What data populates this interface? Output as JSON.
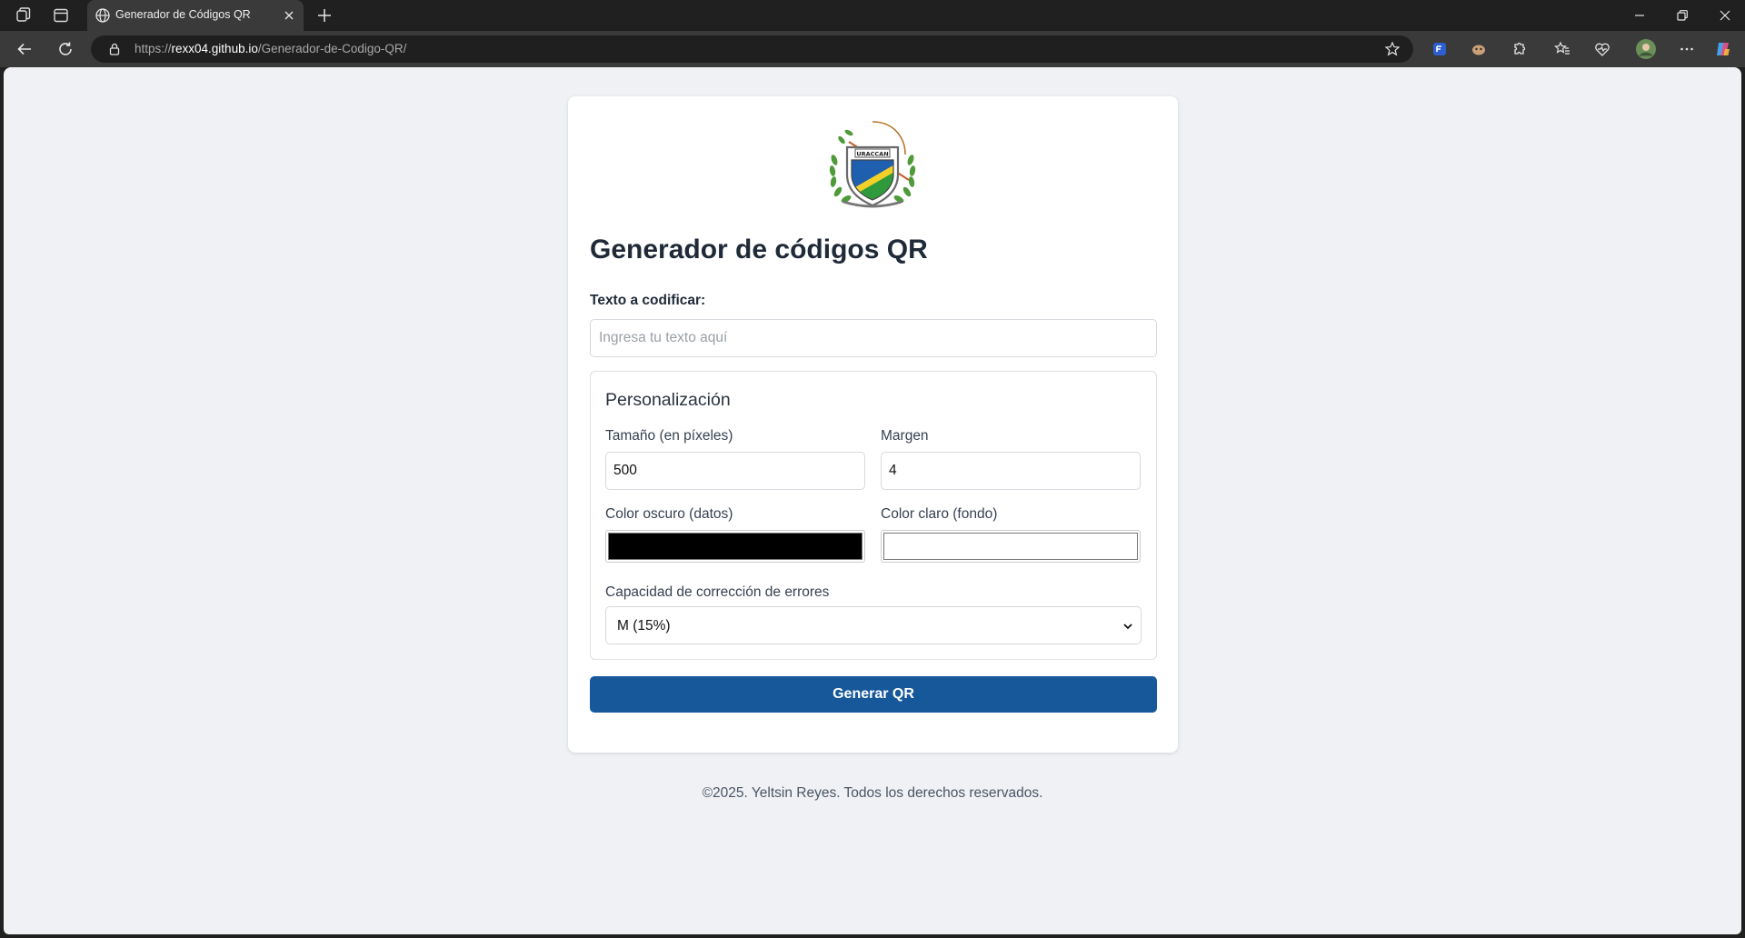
{
  "browser": {
    "tab_title": "Generador de Códigos QR",
    "url_prefix": "https://",
    "url_host": "rexx04.github.io",
    "url_path": "/Generador-de-Codigo-QR/"
  },
  "page": {
    "title": "Generador de códigos QR",
    "text_label": "Texto a codificar:",
    "text_placeholder": "Ingresa tu texto aquí",
    "text_value": "",
    "custom": {
      "legend": "Personalización",
      "size_label": "Tamaño (en píxeles)",
      "size_value": "500",
      "margin_label": "Margen",
      "margin_value": "4",
      "dark_label": "Color oscuro (datos)",
      "dark_color": "#000000",
      "light_label": "Color claro (fondo)",
      "light_color": "#ffffff",
      "ecc_label": "Capacidad de corrección de errores",
      "ecc_value": "M (15%)"
    },
    "generate_button": "Generar QR",
    "footer": "©2025. Yeltsin Reyes. Todos los derechos reservados."
  },
  "colors": {
    "primary_button": "#17589b",
    "page_background": "#eff1f5"
  },
  "icons": [
    "workspaces-icon",
    "tab-actions-icon",
    "globe-icon",
    "close-icon",
    "plus-icon",
    "back-icon",
    "refresh-icon",
    "lock-icon",
    "star-icon",
    "extension-icon",
    "favorites-icon",
    "menu-icon",
    "copilot-icon",
    "minimize-icon",
    "restore-icon"
  ]
}
